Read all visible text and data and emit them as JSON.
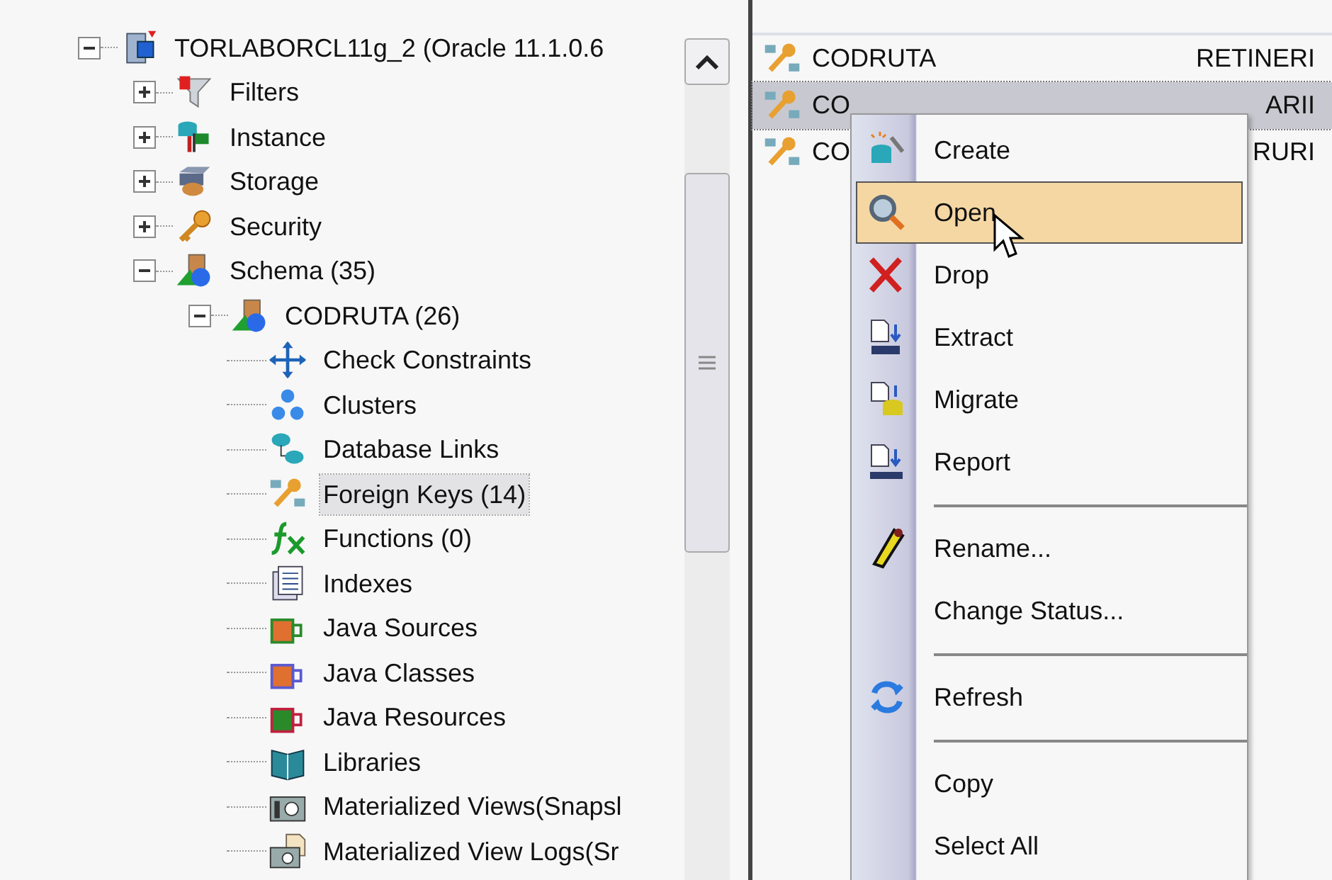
{
  "tree": [
    {
      "label": "TORLABORCL11g_2 (Oracle 11.1.0.6",
      "expanded": true,
      "selected": false,
      "children": [
        {
          "label": "Filters",
          "expanded": false,
          "selected": false
        },
        {
          "label": "Instance",
          "expanded": false,
          "selected": false
        },
        {
          "label": "Storage",
          "expanded": false,
          "selected": false
        },
        {
          "label": "Security",
          "expanded": false,
          "selected": false
        },
        {
          "label": "Schema (35)",
          "expanded": true,
          "selected": false,
          "children": [
            {
              "label": "CODRUTA (26)",
              "expanded": true,
              "selected": false,
              "children": [
                {
                  "label": "Check Constraints",
                  "selected": false
                },
                {
                  "label": "Clusters",
                  "selected": false
                },
                {
                  "label": "Database Links",
                  "selected": false
                },
                {
                  "label": "Foreign Keys (14)",
                  "selected": true
                },
                {
                  "label": "Functions (0)",
                  "selected": false
                },
                {
                  "label": "Indexes",
                  "selected": false
                },
                {
                  "label": "Java Sources",
                  "selected": false
                },
                {
                  "label": "Java Classes",
                  "selected": false
                },
                {
                  "label": "Java Resources",
                  "selected": false
                },
                {
                  "label": "Libraries",
                  "selected": false
                },
                {
                  "label": "Materialized Views(Snapsl",
                  "selected": false
                },
                {
                  "label": "Materialized View Logs(Sr",
                  "selected": false
                }
              ]
            }
          ]
        }
      ]
    }
  ],
  "objects": {
    "rows": [
      {
        "name": "CODRUTA",
        "table": "RETINERI",
        "selected": false
      },
      {
        "name": "CO",
        "table": "ARII",
        "selected": true
      },
      {
        "name": "CO",
        "table": "RURI",
        "selected": false
      }
    ]
  },
  "menu": {
    "items": [
      {
        "kind": "item",
        "label": "Create",
        "selected": false
      },
      {
        "kind": "item",
        "label": "Open",
        "selected": true
      },
      {
        "kind": "item",
        "label": "Drop",
        "selected": false
      },
      {
        "kind": "item",
        "label": "Extract",
        "selected": false
      },
      {
        "kind": "item",
        "label": "Migrate",
        "selected": false
      },
      {
        "kind": "item",
        "label": "Report",
        "selected": false
      },
      {
        "kind": "separator"
      },
      {
        "kind": "item",
        "label": "Rename...",
        "selected": false
      },
      {
        "kind": "item",
        "label": "Change Status...",
        "selected": false
      },
      {
        "kind": "separator"
      },
      {
        "kind": "item",
        "label": "Refresh",
        "selected": false
      },
      {
        "kind": "separator"
      },
      {
        "kind": "item",
        "label": "Copy",
        "selected": false
      },
      {
        "kind": "item",
        "label": "Select All",
        "selected": false
      }
    ]
  }
}
